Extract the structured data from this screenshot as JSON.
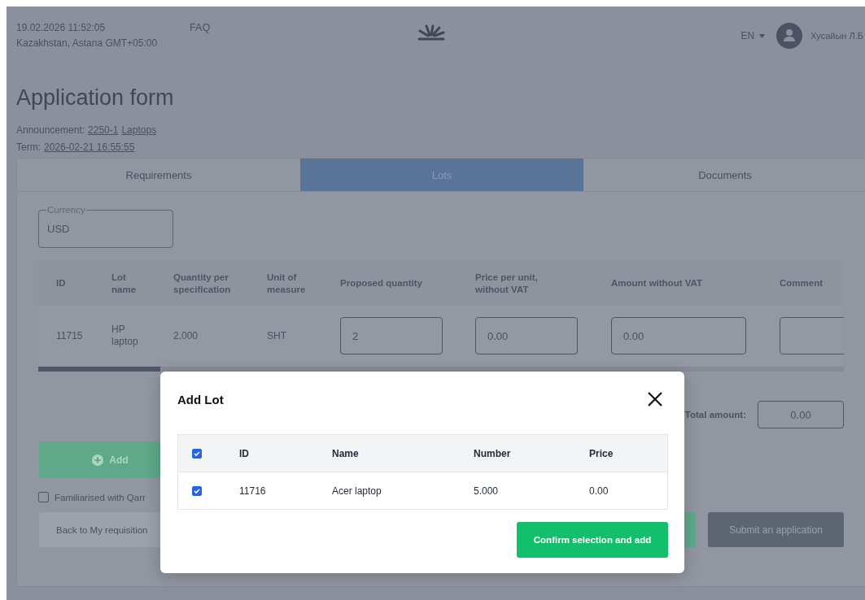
{
  "header": {
    "datetime": "19.02.2026 11:52:05",
    "location": "Kazakhstan, Astana GMT+05:00",
    "faq": "FAQ",
    "language": "EN",
    "user_name": "Хусайын Л.Б"
  },
  "page": {
    "title": "Application form",
    "announcement_label": "Announcement:",
    "announcement_number": "2250-1",
    "announcement_name": "Laptops",
    "term_label": "Term:",
    "term_value": "2026-02-21 16:55:55"
  },
  "tabs": [
    {
      "label": "Requirements",
      "selected": false
    },
    {
      "label": "Lots",
      "selected": true
    },
    {
      "label": "Documents",
      "selected": false
    }
  ],
  "currency": {
    "label": "Currency",
    "value": "USD"
  },
  "lots_table": {
    "columns": [
      "ID",
      "Lot name",
      "Quantity per specification",
      "Unit of measure",
      "Proposed quantity",
      "Price per unit, without VAT",
      "Amount without VAT",
      "Comment"
    ],
    "rows": [
      {
        "id": "11715",
        "lot_name": "HP laptop",
        "quantity": "2.000",
        "unit": "SHT",
        "proposed_quantity": "2",
        "price": "0.00",
        "amount": "0.00"
      }
    ]
  },
  "total": {
    "label": "Total amount:",
    "value": "0.00"
  },
  "add_button": "Add",
  "familiarised": {
    "label": "Familiarised with Qarr",
    "checked": false
  },
  "back_button": "Back to My requisition",
  "submit_button": "Submit an application",
  "modal": {
    "title": "Add Lot",
    "select_all_checked": true,
    "columns": [
      "ID",
      "Name",
      "Number",
      "Price"
    ],
    "rows": [
      {
        "id": "11716",
        "name": "Acer laptop",
        "number": "5.000",
        "price": "0.00",
        "checked": true
      }
    ],
    "confirm_button": "Confirm selection and add"
  }
}
